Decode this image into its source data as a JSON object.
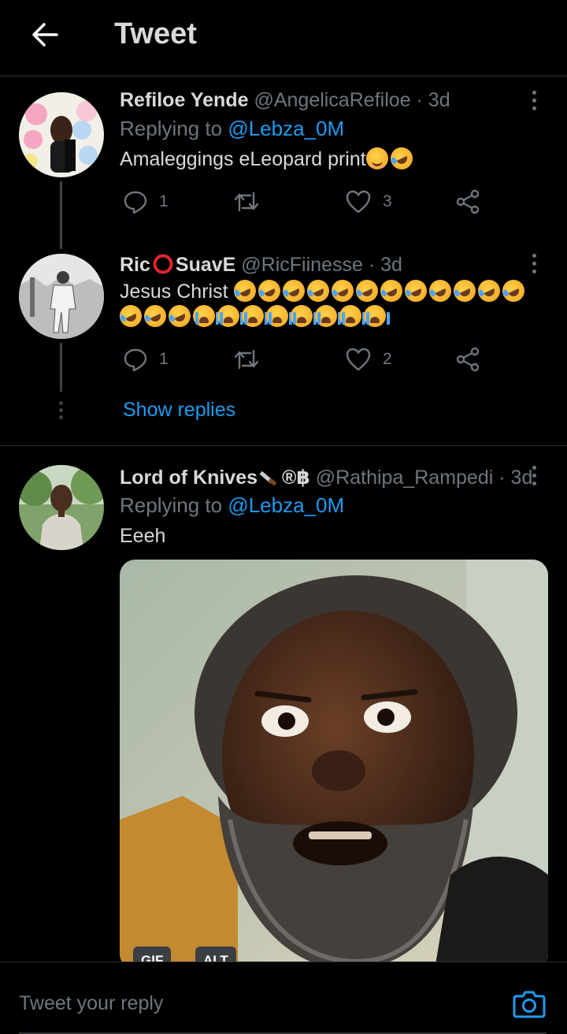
{
  "header": {
    "title": "Tweet",
    "back_icon": "arrow-left-icon"
  },
  "tweets": [
    {
      "name": "Refiloe Yende",
      "handle": "@AngelicaRefiloe",
      "time": "· 3d",
      "replying_prefix": "Replying to ",
      "replying_to": "@Lebza_0M",
      "text": "Amaleggings eLeopard print",
      "text_emojis": [
        "smile-emoji",
        "rofl-emoji"
      ],
      "replies": "1",
      "likes": "3"
    },
    {
      "name_part1": "Ric",
      "name_part2": "SuavE",
      "handle": "@RicFiinesse",
      "time": "· 3d",
      "text": "Jesus Christ",
      "text_emojis_line1_count": 12,
      "text_emojis_line2_rofl_count": 3,
      "text_emojis_line2_cry_count": 8,
      "replies": "1",
      "likes": "2"
    },
    {
      "name": "Lord of Knives",
      "name_suffix": "®฿",
      "handle": "@Rathipa_Rampedi",
      "time": "· 3d",
      "replying_prefix": "Replying to ",
      "replying_to": "@Lebza_0M",
      "text": "Eeeh",
      "media_badges": [
        "GIF",
        "ALT"
      ]
    }
  ],
  "show_replies": "Show replies",
  "reply_bar": {
    "placeholder": "Tweet your reply",
    "camera_icon": "camera-icon"
  },
  "colors": {
    "background": "#000000",
    "accent": "#1d9bf0",
    "muted": "#6e767d",
    "text": "#d9d9d9"
  }
}
